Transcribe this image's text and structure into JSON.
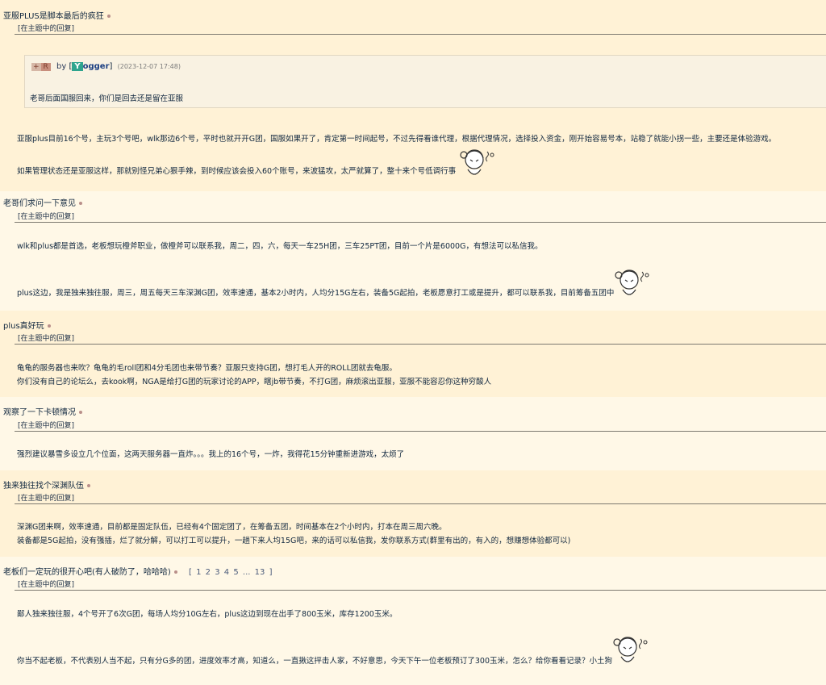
{
  "reply_tag": "[在主题中的回复]",
  "threads": [
    {
      "title": "亚服PLUS是脚本最后的疯狂",
      "quote": {
        "plus_badge": "+",
        "r_badge": "R",
        "by": "by",
        "bracket_open": "[",
        "user_initial": "Y",
        "user_rest": "ogger",
        "bracket_close": "]",
        "time": "(2023-12-07 17:48)",
        "text": "老哥后面国服回来，你们是回去还是留在亚服"
      },
      "posts": [
        "亚服plus目前16个号，主玩3个号吧，wlk那边6个号，平时也就开开G团，国服如果开了，肯定第一时间起号，不过先得看谁代理，根据代理情况，选择投入资金，刚开始容易号本，站稳了就能小拐一些，主要还是体验游戏。",
        "如果管理状态还是亚服这样，那就别怪兄弟心狠手辣，到时候应该会投入60个账号，来波猛攻，太严就算了，整十来个号低调行事"
      ]
    },
    {
      "title": "老哥们求问一下意见",
      "posts": [
        "wlk和plus都是首选，老板想玩橙斧职业，做橙斧可以联系我，周二，四，六，每天一车25H团，三车25PT团，目前一个片是6000G，有想法可以私信我。",
        "plus这边，我是独来独往服，周三，周五每天三车深渊G团，效率速通，基本2小时内，人均分15G左右，装备5G起拍，老板愿意打工或是提升，都可以联系我，目前筹备五团中"
      ]
    },
    {
      "title": "plus真好玩",
      "posts": [
        "龟龟的服务器也来吹？龟龟的毛roll团和4分毛团也来带节奏？亚服只支持G团，想打毛人开的ROLL团就去龟服。",
        "你们没有自己的论坛么，去kook啊，NGA是给打G团的玩家讨论的APP，瞎jb带节奏，不打G团，麻烦滚出亚服，亚服不能容忍你这种穷酸人"
      ]
    },
    {
      "title": "观察了一下卡顿情况",
      "posts": [
        "强烈建议暴雪多设立几个位面，这两天服务器一直炸。。。我上的16个号，一炸，我得花15分钟重新进游戏，太烦了"
      ]
    },
    {
      "title": "独来独往找个深渊队伍",
      "posts": [
        "深渊G团来啊，效率速通，目前都是固定队伍，已经有4个固定团了，在筹备五团，时间基本在2个小时内，打本在周三周六晚。",
        "装备都是5G起拍，没有强插，烂了就分解，可以打工可以提升，一趟下来人均15G吧，来的话可以私信我，发你联系方式(群里有出的，有入的，想赚想体验都可以)"
      ]
    },
    {
      "title": "老板们一定玩的很开心吧(有人破防了，哈哈哈)",
      "pager": {
        "open": "[",
        "pages": [
          "1",
          "2",
          "3",
          "4",
          "5",
          "...",
          "13"
        ],
        "close": "]"
      },
      "posts": [
        "鄙人独来独往服，4个号开了6次G团，每场人均分10G左右，plus这边到现在出手了800玉米，库存1200玉米。",
        "你当不起老板，不代表别人当不起，只有分G多的团，进度效率才高，知道么，一直揪这抨击人家，不好意思，今天下午一位老板预订了300玉米，怎么？给你看看记录？小土狗"
      ]
    }
  ],
  "stickers": [
    "chibi-girl-sticker",
    "chibi-girl-sticker",
    "chibi-girl-sticker"
  ]
}
